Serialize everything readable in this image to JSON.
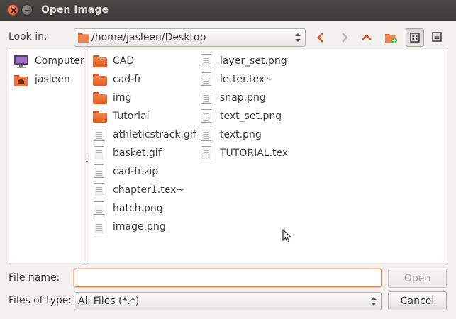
{
  "window": {
    "title": "Open Image"
  },
  "look_in": {
    "label": "Look in:",
    "path": "/home/jasleen/Desktop"
  },
  "toolbar": {
    "icons": [
      "back-icon",
      "forward-icon",
      "up-icon",
      "new-folder-icon",
      "icon-view-icon",
      "list-view-icon"
    ],
    "accent": "#e2561d"
  },
  "places": [
    {
      "label": "Computer",
      "icon": "computer-icon"
    },
    {
      "label": "jasleen",
      "icon": "home-folder-icon"
    }
  ],
  "files": {
    "column1": [
      {
        "name": "CAD",
        "type": "folder"
      },
      {
        "name": "cad-fr",
        "type": "folder"
      },
      {
        "name": "img",
        "type": "folder"
      },
      {
        "name": "Tutorial",
        "type": "folder"
      },
      {
        "name": "athleticstrack.gif",
        "type": "file"
      },
      {
        "name": "basket.gif",
        "type": "file"
      },
      {
        "name": "cad-fr.zip",
        "type": "file"
      },
      {
        "name": "chapter1.tex~",
        "type": "file"
      },
      {
        "name": "hatch.png",
        "type": "file"
      },
      {
        "name": "image.png",
        "type": "file"
      }
    ],
    "column2": [
      {
        "name": "layer_set.png",
        "type": "file"
      },
      {
        "name": "letter.tex~",
        "type": "file"
      },
      {
        "name": "snap.png",
        "type": "file"
      },
      {
        "name": "text_set.png",
        "type": "file"
      },
      {
        "name": "text.png",
        "type": "file"
      },
      {
        "name": "TUTORIAL.tex",
        "type": "file"
      }
    ]
  },
  "file_name": {
    "label": "File name:",
    "value": "",
    "placeholder": ""
  },
  "file_type": {
    "label": "Files of type:",
    "value": "All Files (*.*)"
  },
  "buttons": {
    "open": "Open",
    "cancel": "Cancel"
  }
}
